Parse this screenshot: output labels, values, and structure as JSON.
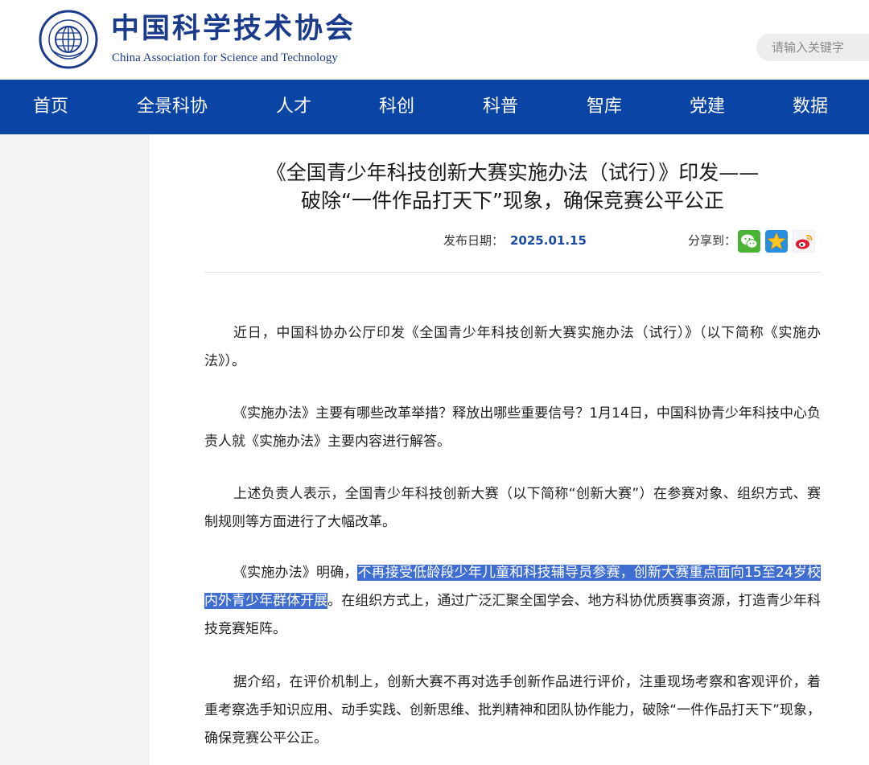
{
  "header": {
    "brand_cn": "中国科学技术协会",
    "brand_en": "China Association for Science and Technology",
    "search_placeholder": "请输入关键字"
  },
  "nav": {
    "items": [
      "首页",
      "全景科协",
      "人才",
      "科创",
      "科普",
      "智库",
      "党建",
      "数据"
    ]
  },
  "article": {
    "title_line1": "《全国青少年科技创新大赛实施办法（试行）》印发——",
    "title_line2": "破除“一件作品打天下”现象，确保竞赛公平公正",
    "date_label": "发布日期：",
    "date": "2025.01.15",
    "share_label": "分享到：",
    "share_icons": [
      "wechat-icon",
      "qzone-icon",
      "weibo-icon"
    ],
    "p1": "近日，中国科协办公厅印发《全国青少年科技创新大赛实施办法（试行）》（以下简称《实施办法》）。",
    "p2": "《实施办法》主要有哪些改革举措？释放出哪些重要信号？1月14日，中国科协青少年科技中心负责人就《实施办法》主要内容进行解答。",
    "p3": "上述负责人表示，全国青少年科技创新大赛（以下简称“创新大赛”）在参赛对象、组织方式、赛制规则等方面进行了大幅改革。",
    "p4_before": "《实施办法》明确，",
    "p4_highlight": "不再接受低龄段少年儿童和科技辅导员参赛，创新大赛重点面向15至24岁校内外青少年群体开展",
    "p4_after": "。在组织方式上，通过广泛汇聚全国学会、地方科协优质赛事资源，打造青少年科技竞赛矩阵。",
    "p5": "据介绍，在评价机制上，创新大赛不再对选手创新作品进行评价，注重现场考察和客观评价，着重考察选手知识应用、动手实践、创新思维、批判精神和团队协作能力，破除“一件作品打天下”现象，确保竞赛公平公正。"
  },
  "colors": {
    "nav_bg": "#0a44a5",
    "brand": "#1a3a8c",
    "highlight": "#3f6ed0"
  }
}
